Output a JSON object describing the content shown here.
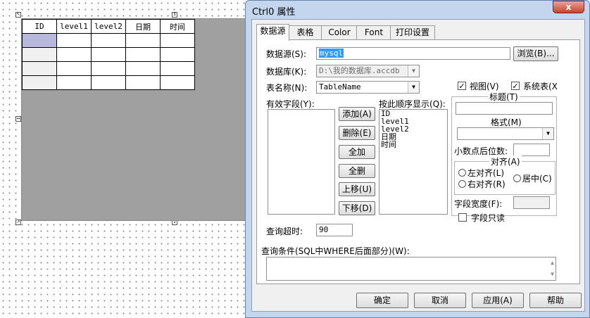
{
  "designer": {
    "headers": [
      "ID",
      "level1",
      "level2",
      "日期",
      "时间"
    ],
    "row_count": 4
  },
  "dialog": {
    "title": "Ctrl0 属性",
    "close_glyph": "x",
    "tabs": [
      "数据源",
      "表格",
      "Color",
      "Font",
      "打印设置"
    ],
    "datasource": {
      "label": "数据源(S):",
      "value": "mysql",
      "browse_label": "浏览(B)..."
    },
    "database": {
      "label": "数据库(K):",
      "value": "D:\\我的数据库.accdb"
    },
    "tablename": {
      "label": "表名称(N):",
      "value": "TableName"
    },
    "view_check": {
      "label": "视图(V)",
      "checked": true
    },
    "systable_check": {
      "label": "系统表(X",
      "checked": true
    },
    "valid_fields_label": "有效字段(Y):",
    "order_label": "按此顺序显示(Q):",
    "order_items": [
      "ID",
      "level1",
      "level2",
      "日期",
      "时间"
    ],
    "buttons": {
      "add": "添加(A)",
      "delete": "删除(E)",
      "add_all": "全加",
      "delete_all": "全删",
      "move_up": "上移(U)",
      "move_down": "下移(D)"
    },
    "title_group": {
      "label": "标题(T)",
      "value": ""
    },
    "format_group": {
      "label": "格式(M)",
      "value": ""
    },
    "decimal_label": "小数点后位数:",
    "decimal_value": "",
    "align_group": {
      "label": "对齐(A)",
      "left": "左对齐(L)",
      "right": "右对齐(R)",
      "center": "居中(C)"
    },
    "field_width_label": "字段宽度(F):",
    "field_width_value": "",
    "readonly_check": {
      "label": "字段只读",
      "checked": false
    },
    "timeout_label": "查询超时:",
    "timeout_value": "90",
    "where_label": "查询条件(SQL中WHERE后面部分)(W):",
    "where_value": "",
    "footer": {
      "ok": "确定",
      "cancel": "取消",
      "apply": "应用(A)",
      "help": "帮助"
    }
  }
}
